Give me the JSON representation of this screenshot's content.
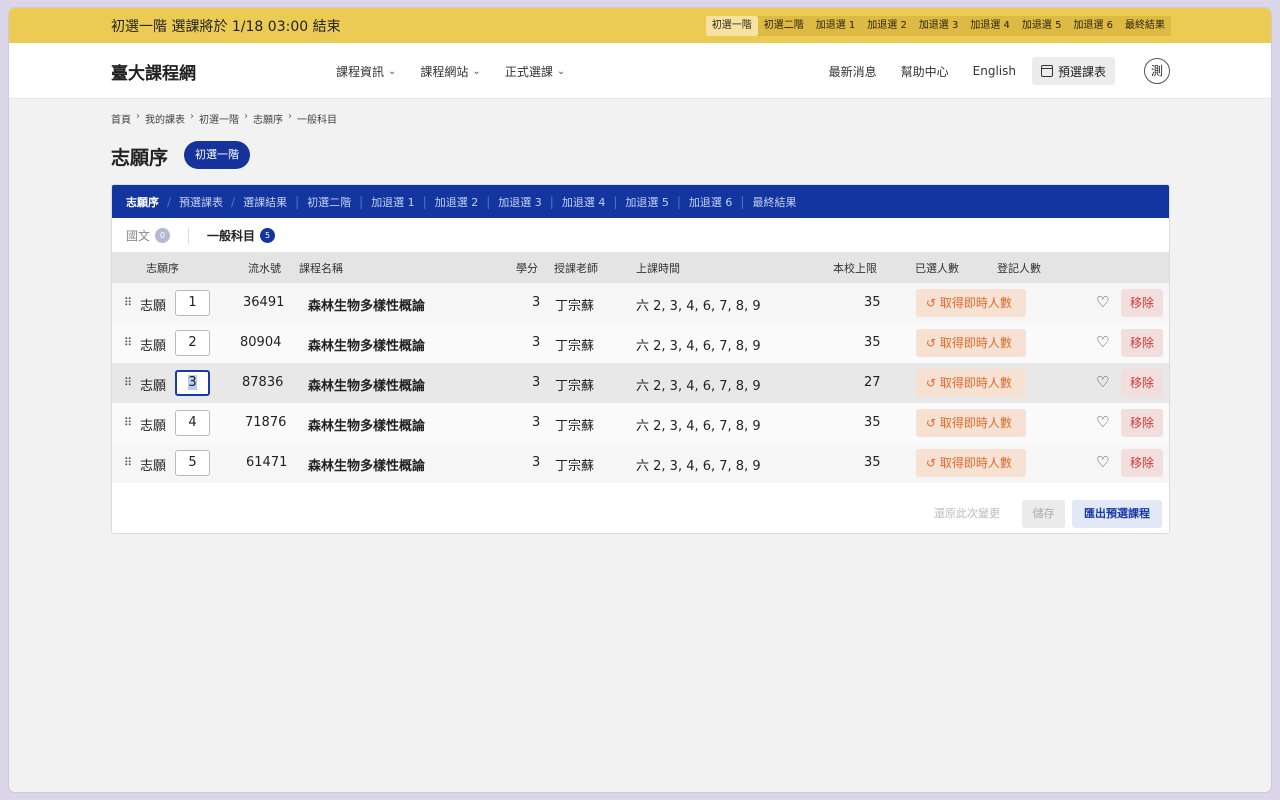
{
  "announce": {
    "message": "初選一階 選課將於 1/18 03:00 結束",
    "phases": [
      "初選一階",
      "初選二階",
      "加退選 1",
      "加退選 2",
      "加退選 3",
      "加退選 4",
      "加退選 5",
      "加退選 6",
      "最終結果"
    ],
    "active_phase": 0
  },
  "nav": {
    "logo": "臺大課程網",
    "menus": [
      "課程資訊",
      "課程網站",
      "正式選課"
    ],
    "links": [
      "最新消息",
      "幫助中心",
      "English"
    ],
    "preschedule_label": "預選課表",
    "avatar_text": "測"
  },
  "breadcrumb": [
    "首頁",
    "我的課表",
    "初選一階",
    "志願序",
    "一般科目"
  ],
  "page": {
    "title": "志願序",
    "phase_pill": "初選一階"
  },
  "tabs": [
    "志願序",
    "預選課表",
    "選課結果",
    "初選二階",
    "加退選 1",
    "加退選 2",
    "加退選 3",
    "加退選 4",
    "加退選 5",
    "加退選 6",
    "最終結果"
  ],
  "subtabs": [
    {
      "label": "國文",
      "count": "0"
    },
    {
      "label": "一般科目",
      "count": "5"
    }
  ],
  "table": {
    "headers": {
      "rank": "志願序",
      "serial": "流水號",
      "name": "課程名稱",
      "credits": "學分",
      "teacher": "授課老師",
      "time": "上課時間",
      "limit": "本校上限",
      "selected": "已選人數",
      "registered": "登記人數"
    },
    "rank_prefix": "志願",
    "realtime_label": "取得即時人數",
    "remove_label": "移除",
    "rows": [
      {
        "rank": "1",
        "serial": "36491",
        "name": "森林生物多樣性概論",
        "credits": "3",
        "teacher": "丁宗蘇",
        "time": "六 2, 3, 4, 6, 7, 8, 9",
        "limit": "35"
      },
      {
        "rank": "2",
        "serial": "80904",
        "name": "森林生物多樣性概論",
        "credits": "3",
        "teacher": "丁宗蘇",
        "time": "六 2, 3, 4, 6, 7, 8, 9",
        "limit": "35"
      },
      {
        "rank": "3",
        "serial": "87836",
        "name": "森林生物多樣性概論",
        "credits": "3",
        "teacher": "丁宗蘇",
        "time": "六 2, 3, 4, 6, 7, 8, 9",
        "limit": "27"
      },
      {
        "rank": "4",
        "serial": "71876",
        "name": "森林生物多樣性概論",
        "credits": "3",
        "teacher": "丁宗蘇",
        "time": "六 2, 3, 4, 6, 7, 8, 9",
        "limit": "35"
      },
      {
        "rank": "5",
        "serial": "61471",
        "name": "森林生物多樣性概論",
        "credits": "3",
        "teacher": "丁宗蘇",
        "time": "六 2, 3, 4, 6, 7, 8, 9",
        "limit": "35"
      }
    ]
  },
  "footer": {
    "reset_label": "還原此次變更",
    "save_label": "儲存",
    "export_label": "匯出預選課程"
  }
}
